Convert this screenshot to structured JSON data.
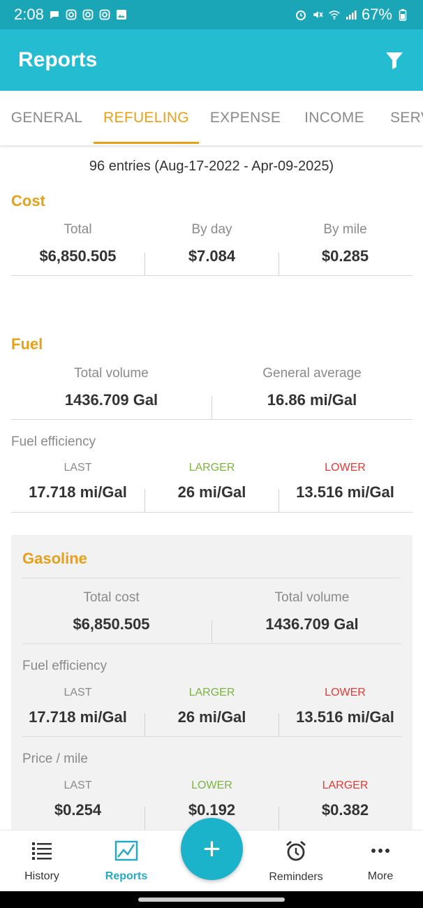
{
  "status_bar": {
    "time": "2:08",
    "battery": "67%"
  },
  "app_bar": {
    "title": "Reports",
    "filter_icon": "filter-icon"
  },
  "tabs": [
    {
      "label": "GENERAL"
    },
    {
      "label": "REFUELING"
    },
    {
      "label": "EXPENSE"
    },
    {
      "label": "INCOME"
    },
    {
      "label": "SERV"
    }
  ],
  "summary": "96 entries (Aug-17-2022 - Apr-09-2025)",
  "cost": {
    "title": "Cost",
    "items": [
      {
        "label": "Total",
        "value": "$6,850.505"
      },
      {
        "label": "By day",
        "value": "$7.084"
      },
      {
        "label": "By mile",
        "value": "$0.285"
      }
    ]
  },
  "fuel": {
    "title": "Fuel",
    "total_volume_label": "Total volume",
    "total_volume": "1436.709 Gal",
    "general_average_label": "General average",
    "general_average": "16.86 mi/Gal",
    "efficiency_label": "Fuel efficiency",
    "efficiency": [
      {
        "label": "LAST",
        "value": "17.718 mi/Gal"
      },
      {
        "label": "LARGER",
        "value": "26 mi/Gal"
      },
      {
        "label": "LOWER",
        "value": "13.516 mi/Gal"
      }
    ]
  },
  "gasoline": {
    "title": "Gasoline",
    "total_cost_label": "Total cost",
    "total_cost": "$6,850.505",
    "total_volume_label": "Total volume",
    "total_volume": "1436.709 Gal",
    "efficiency_label": "Fuel efficiency",
    "efficiency": [
      {
        "label": "LAST",
        "value": "17.718 mi/Gal"
      },
      {
        "label": "LARGER",
        "value": "26 mi/Gal"
      },
      {
        "label": "LOWER",
        "value": "13.516 mi/Gal"
      }
    ],
    "price_label": "Price / mile",
    "price": [
      {
        "label": "LAST",
        "value": "$0.254"
      },
      {
        "label": "LOWER",
        "value": "$0.192"
      },
      {
        "label": "LARGER",
        "value": "$0.382"
      }
    ]
  },
  "bottom_nav": [
    {
      "label": "History",
      "icon": "list-icon"
    },
    {
      "label": "Reports",
      "icon": "chart-icon"
    },
    {
      "label": "Reminders",
      "icon": "alarm-icon"
    },
    {
      "label": "More",
      "icon": "more-dots-icon"
    }
  ],
  "fab_label": "+",
  "colors": {
    "primary": "#23bcd0",
    "accent": "#e6a118",
    "positive": "#7cb342",
    "negative": "#e53935"
  }
}
